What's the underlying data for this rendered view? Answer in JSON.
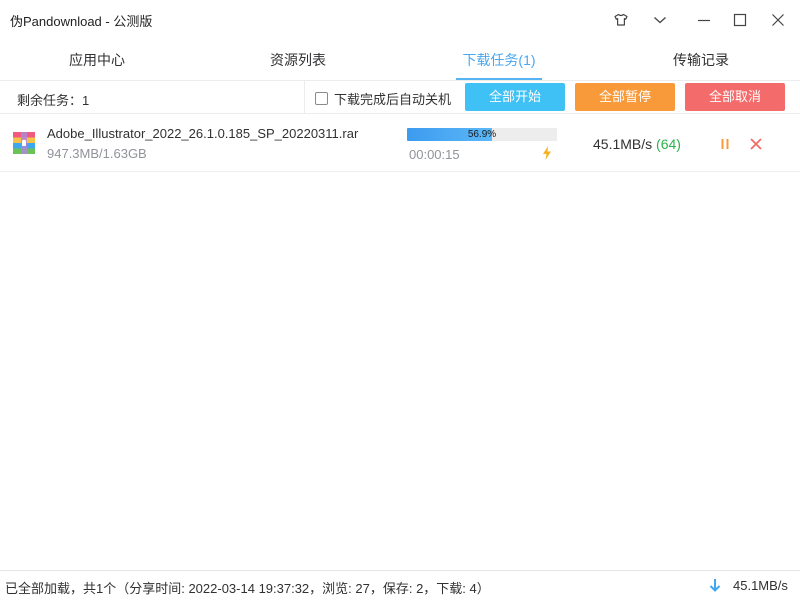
{
  "window": {
    "title": "伪Pandownload - 公测版",
    "icons": [
      "shirt-icon",
      "chevron-down-icon",
      "minimize-icon",
      "maximize-icon",
      "close-icon"
    ]
  },
  "tabs": [
    {
      "label": "应用中心",
      "active": false
    },
    {
      "label": "资源列表",
      "active": false
    },
    {
      "label": "下载任务(1)",
      "active": true
    },
    {
      "label": "传输记录",
      "active": false
    }
  ],
  "toolbar": {
    "remaining": "剩余任务：1",
    "auto_shutdown_label": "下载完成后自动关机",
    "auto_shutdown_checked": false,
    "start_all": "全部开始",
    "pause_all": "全部暂停",
    "cancel_all": "全部取消"
  },
  "downloads": [
    {
      "name": "Adobe_Illustrator_2022_26.1.0.185_SP_20220311.rar",
      "size": "947.3MB/1.63GB",
      "progress_text": "56.9%",
      "progress": 0.569,
      "elapsed": "00:00:15",
      "speed": "45.1MB/s",
      "connections": "(64)"
    }
  ],
  "status": {
    "text": "已全部加载，共1个（分享时间: 2022-03-14 19:37:32，浏览: 27，保存: 2，下载: 4）",
    "speed": "45.1MB/s"
  },
  "colors": {
    "accent": "#4aa8f0",
    "start_button": "#3fc1f5",
    "pause_button": "#f89a3a",
    "cancel_button": "#f46b6b",
    "connections": "#2bb24c"
  }
}
